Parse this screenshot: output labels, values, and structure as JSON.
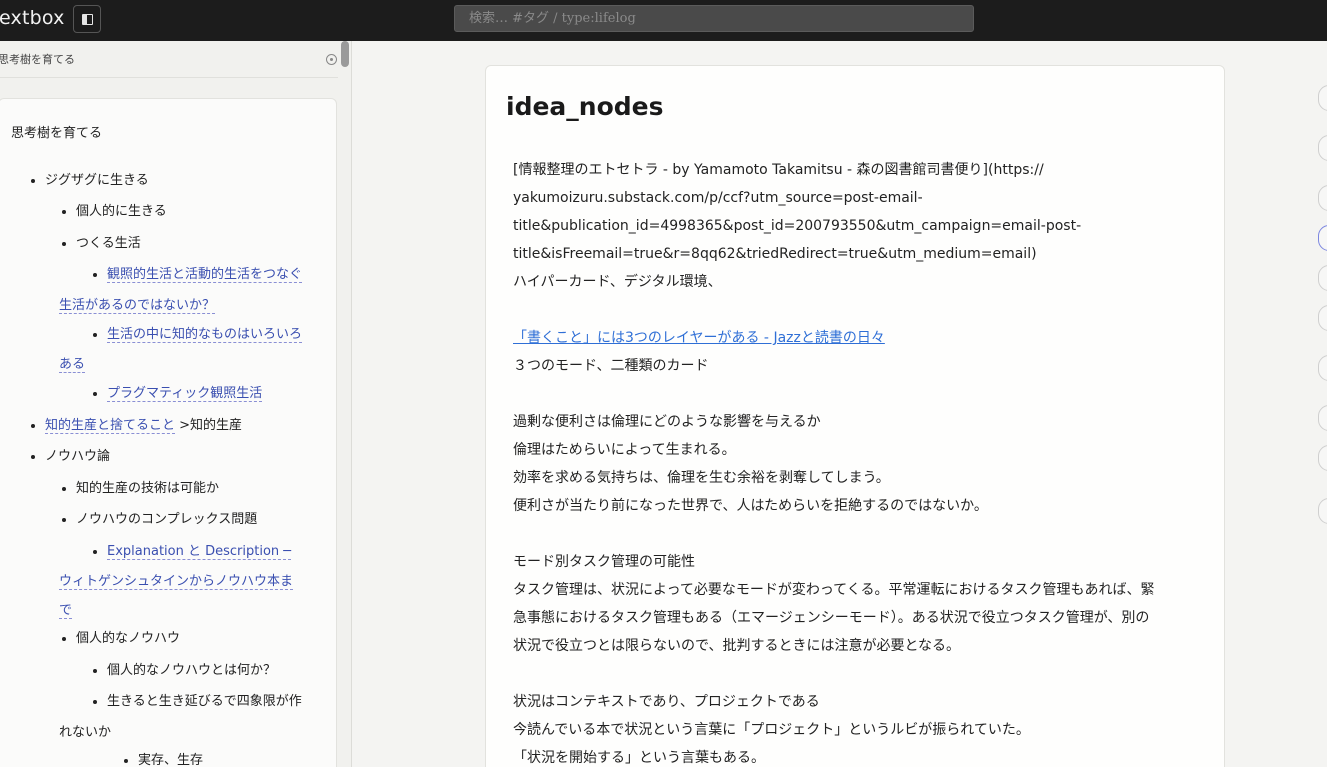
{
  "app": {
    "title": "extbox"
  },
  "search": {
    "placeholder": "検索… #タグ / type:lifelog"
  },
  "sidebar": {
    "header_title": "思考樹を育てる",
    "tree_title": "思考樹を育てる",
    "items": [
      {
        "text": "ジグザグに生きる"
      },
      {
        "text": "個人的に生きる"
      },
      {
        "text": "つくる生活"
      },
      {
        "link_line1": "観照的生活と活動的生活をつなぐ",
        "link_line2": "生活があるのではないか？"
      },
      {
        "link_line1": "生活の中に知的なものはいろいろ",
        "link_line2": "ある"
      },
      {
        "link": "プラグマティック観照生活"
      },
      {
        "link": "知的生産と捨てること",
        "suffix": " >知的生産"
      },
      {
        "text": "ノウハウ論"
      },
      {
        "text": "知的生産の技術は可能か"
      },
      {
        "text": "ノウハウのコンプレックス問題"
      },
      {
        "link_line1": "Explanation と Description ─",
        "link_line2": "ウィトゲンシュタインからノウハウ本ま",
        "link_line3": "で"
      },
      {
        "text": "個人的なノウハウ"
      },
      {
        "text": "個人的なノウハウとは何か？"
      },
      {
        "text_line1": "生きると生き延びるで四象限が作",
        "text_line2": "れないか"
      },
      {
        "text": "実存、生存"
      }
    ]
  },
  "main": {
    "title": "idea_nodes",
    "lines": [
      "[情報整理のエトセトラ - by Yamamoto Takamitsu - 森の図書館司書便り](https://",
      "yakumoizuru.substack.com/p/ccf?utm_source=post-email-",
      "title&publication_id=4998365&post_id=200793550&utm_campaign=email-post-",
      "title&isFreemail=true&r=8qq62&triedRedirect=true&utm_medium=email)",
      "ハイパーカード、デジタル環境、",
      "「書くこと」には3つのレイヤーがある - Jazzと読書の日々",
      "３つのモード、二種類のカード",
      "過剰な便利さは倫理にどのような影響を与えるか",
      "倫理はためらいによって生まれる。",
      "効率を求める気持ちは、倫理を生む余裕を剥奪してしまう。",
      "便利さが当たり前になった世界で、人はためらいを拒絶するのではないか。",
      "モード別タスク管理の可能性",
      "タスク管理は、状況によって必要なモードが変わってくる。平常運転におけるタスク管理もあれば、緊",
      "急事態におけるタスク管理もある（エマージェンシーモード）。ある状況で役立つタスク管理が、別の",
      "状況で役立つとは限らないので、批判するときには注意が必要となる。",
      "状況はコンテキストであり、プロジェクトである",
      "今読んでいる本で状況という言葉に「プロジェクト」というルビが振られていた。",
      "「状況を開始する」という言葉もある。"
    ]
  },
  "colors": {
    "topbar": "#1c1c1c",
    "link": "#2f6fd6",
    "sidebar_link": "#3a4fb0"
  }
}
